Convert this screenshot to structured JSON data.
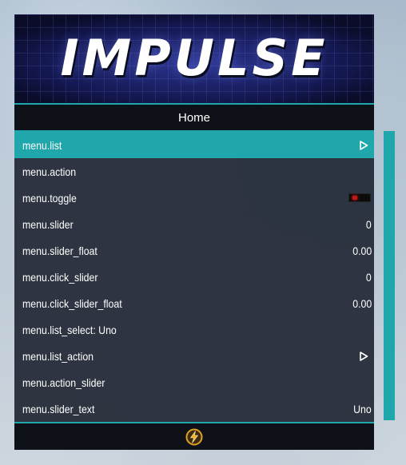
{
  "header": {
    "logo_text": "IMPULSE"
  },
  "subheader": {
    "title": "Home"
  },
  "items": [
    {
      "label": "menu.list",
      "value": "",
      "type": "submenu",
      "selected": true
    },
    {
      "label": "menu.action",
      "value": "",
      "type": "action",
      "selected": false
    },
    {
      "label": "menu.toggle",
      "value": "",
      "type": "toggle",
      "toggled": false,
      "selected": false
    },
    {
      "label": "menu.slider",
      "value": "0",
      "type": "slider",
      "selected": false
    },
    {
      "label": "menu.slider_float",
      "value": "0.00",
      "type": "slider",
      "selected": false
    },
    {
      "label": "menu.click_slider",
      "value": "0",
      "type": "slider",
      "selected": false
    },
    {
      "label": "menu.click_slider_float",
      "value": "0.00",
      "type": "slider",
      "selected": false
    },
    {
      "label": "menu.list_select: Uno",
      "value": "",
      "type": "list",
      "selected": false
    },
    {
      "label": "menu.list_action",
      "value": "",
      "type": "submenu",
      "selected": false
    },
    {
      "label": "menu.action_slider",
      "value": "",
      "type": "action",
      "selected": false
    },
    {
      "label": "menu.slider_text",
      "value": "Uno",
      "type": "slider",
      "selected": false
    }
  ],
  "footer": {
    "icon": "lightning-bolt-icon"
  },
  "colors": {
    "accent": "#20a7ab",
    "item_background": "#282e3a",
    "header_background": "#0d1030",
    "toggle_off": "#c41616"
  }
}
